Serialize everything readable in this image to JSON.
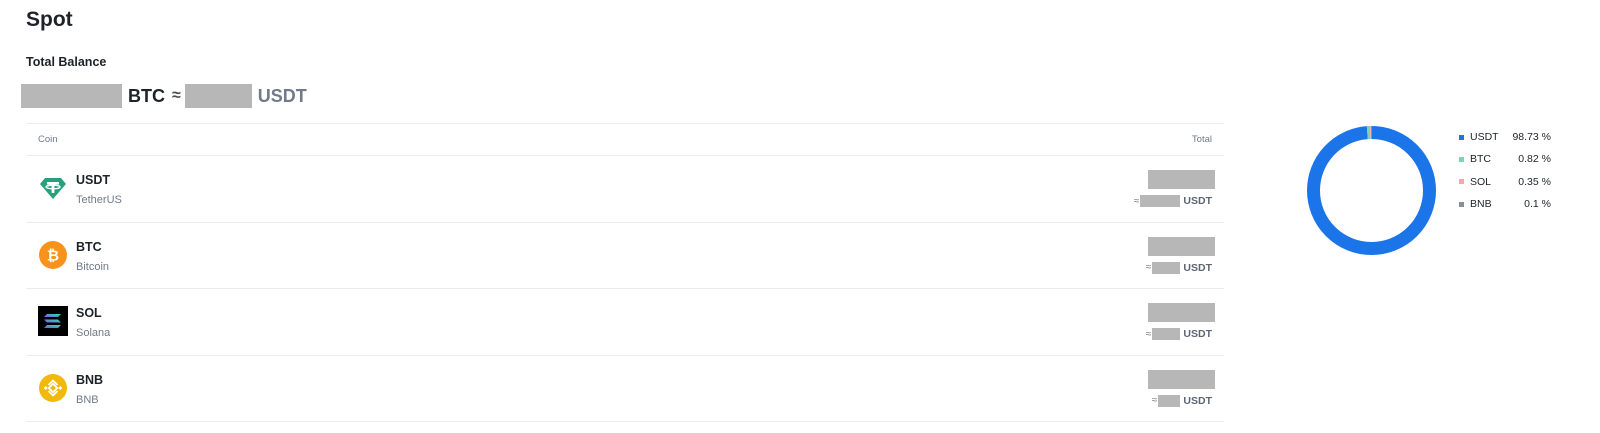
{
  "page": {
    "title": "Spot",
    "total_balance_label": "Total Balance",
    "balance_btc_unit": "BTC",
    "approx_symbol": "≈",
    "balance_usdt_unit": "USDT"
  },
  "table": {
    "columns": [
      "Coin",
      "Total"
    ],
    "rows": [
      {
        "symbol": "USDT",
        "name": "TetherUS",
        "icon": "tether-icon",
        "approx_unit": "USDT"
      },
      {
        "symbol": "BTC",
        "name": "Bitcoin",
        "icon": "bitcoin-icon",
        "approx_unit": "USDT"
      },
      {
        "symbol": "SOL",
        "name": "Solana",
        "icon": "solana-icon",
        "approx_unit": "USDT"
      },
      {
        "symbol": "BNB",
        "name": "BNB",
        "icon": "bnb-icon",
        "approx_unit": "USDT"
      }
    ]
  },
  "allocation": {
    "items": [
      {
        "label": "USDT",
        "percent": 98.73,
        "percent_text": "98.73 %",
        "color": "#1c74e9"
      },
      {
        "label": "BTC",
        "percent": 0.82,
        "percent_text": "0.82 %",
        "color": "#76d7b4"
      },
      {
        "label": "SOL",
        "percent": 0.35,
        "percent_text": "0.35 %",
        "color": "#f7a6a6"
      },
      {
        "label": "BNB",
        "percent": 0.1,
        "percent_text": "0.1 %",
        "color": "#848e9c"
      }
    ]
  }
}
